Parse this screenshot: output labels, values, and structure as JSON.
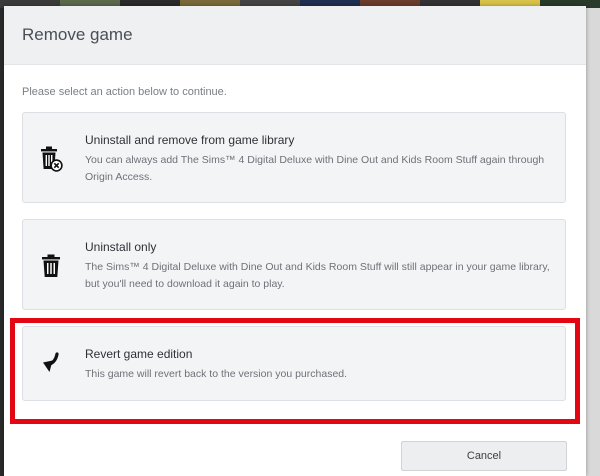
{
  "background": {
    "tile_colors": [
      "#3b3b3b",
      "#5b6a4a",
      "#2b2b2b",
      "#7a6a3a",
      "#444444",
      "#1f2f4f",
      "#6b3b2b",
      "#333333",
      "#d9c24a",
      "#2a3a2a"
    ]
  },
  "dialog": {
    "title": "Remove game",
    "instruction": "Please select an action below to continue.",
    "options": [
      {
        "icon": "trash-remove-icon",
        "title": "Uninstall and remove from game library",
        "description": "You can always add The Sims™ 4 Digital Deluxe with Dine Out and Kids Room Stuff again through Origin Access."
      },
      {
        "icon": "trash-icon",
        "title": "Uninstall only",
        "description": "The Sims™ 4 Digital Deluxe with Dine Out and Kids Room Stuff will still appear in your game library, but you'll need to download it again to play."
      },
      {
        "icon": "revert-arrow-icon",
        "title": "Revert game edition",
        "description": "This game will revert back to the version you purchased."
      }
    ],
    "cancel_label": "Cancel"
  },
  "colors": {
    "highlight": "#e30613",
    "header_bg": "#eef0f2",
    "option_bg": "#f3f4f6"
  }
}
